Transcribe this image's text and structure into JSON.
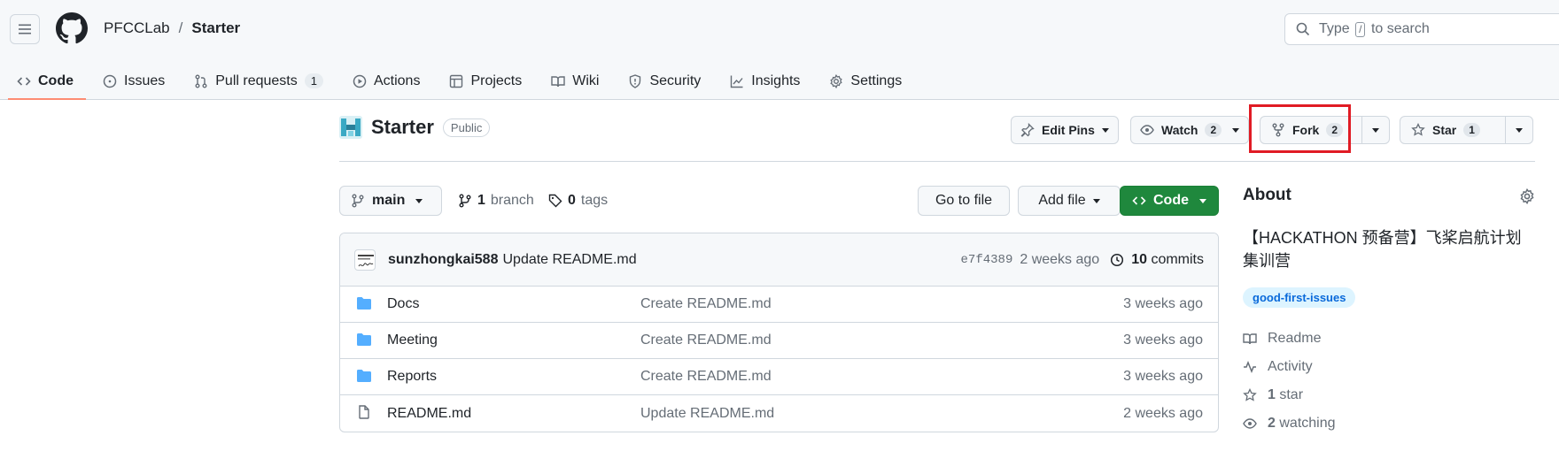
{
  "header": {
    "org": "PFCCLab",
    "separator": "/",
    "repo": "Starter",
    "search_prefix": "Type",
    "search_key": "/",
    "search_suffix": "to search"
  },
  "tabs": [
    {
      "label": "Code",
      "icon": "code-icon"
    },
    {
      "label": "Issues",
      "icon": "issue-icon"
    },
    {
      "label": "Pull requests",
      "icon": "pull-request-icon",
      "count": "1"
    },
    {
      "label": "Actions",
      "icon": "play-icon"
    },
    {
      "label": "Projects",
      "icon": "table-icon"
    },
    {
      "label": "Wiki",
      "icon": "book-icon"
    },
    {
      "label": "Security",
      "icon": "shield-icon"
    },
    {
      "label": "Insights",
      "icon": "graph-icon"
    },
    {
      "label": "Settings",
      "icon": "gear-icon"
    }
  ],
  "repo_head": {
    "name": "Starter",
    "visibility": "Public",
    "edit_pins": "Edit Pins",
    "watch_label": "Watch",
    "watch_count": "2",
    "fork_label": "Fork",
    "fork_count": "2",
    "star_label": "Star",
    "star_count": "1"
  },
  "toolbar": {
    "branch": "main",
    "branch_count": "1",
    "branch_word": "branch",
    "tag_count": "0",
    "tag_word": "tags",
    "go_to_file": "Go to file",
    "add_file": "Add file",
    "code": "Code"
  },
  "latest_commit": {
    "author": "sunzhongkai588",
    "message": "Update README.md",
    "sha": "e7f4389",
    "time": "2 weeks ago",
    "commit_count": "10",
    "commit_word": "commits"
  },
  "files": [
    {
      "name": "Docs",
      "type": "folder",
      "message": "Create README.md",
      "time": "3 weeks ago"
    },
    {
      "name": "Meeting",
      "type": "folder",
      "message": "Create README.md",
      "time": "3 weeks ago"
    },
    {
      "name": "Reports",
      "type": "folder",
      "message": "Create README.md",
      "time": "3 weeks ago"
    },
    {
      "name": "README.md",
      "type": "file",
      "message": "Update README.md",
      "time": "2 weeks ago"
    }
  ],
  "about": {
    "title": "About",
    "description": "【HACKATHON 预备营】飞桨启航计划集训营",
    "topic": "good-first-issues",
    "readme": "Readme",
    "activity": "Activity",
    "stars_count": "1",
    "stars_word": "star",
    "watching_count": "2",
    "watching_word": "watching"
  },
  "colors": {
    "accent_green": "#1f883d",
    "tab_underline": "#fd8c73",
    "folder_blue": "#54aeff",
    "highlight_red": "#e01b24",
    "topic_blue": "#0969da"
  }
}
